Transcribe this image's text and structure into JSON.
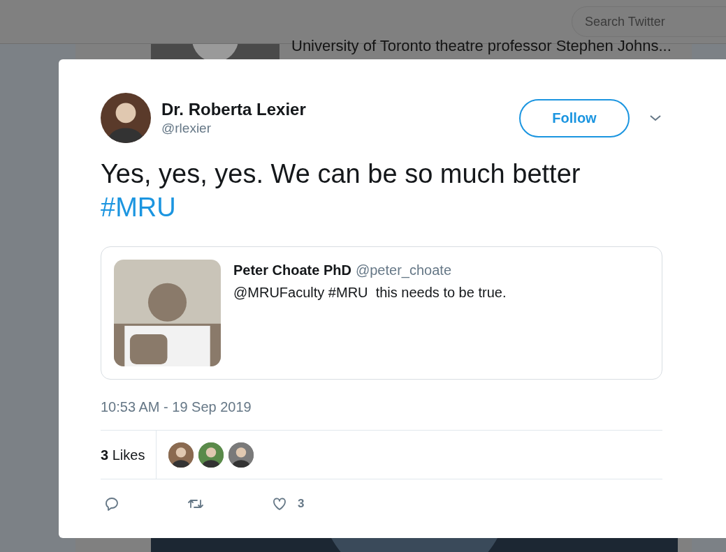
{
  "top_bar": {
    "search": {
      "placeholder": "Search Twitter"
    }
  },
  "background_feed": {
    "headline": "University of Toronto theatre professor Stephen Johns..."
  },
  "tweet": {
    "author": {
      "name": "Dr. Roberta Lexier",
      "handle": "@rlexier"
    },
    "follow_button": "Follow",
    "text_lines": [
      {
        "kind": "plain",
        "text": "Yes, yes, yes. We can be so much better"
      },
      {
        "kind": "hashtag",
        "text": "#MRU"
      }
    ],
    "quoted_tweet": {
      "name": "Peter Choate PhD",
      "handle": "@peter_choate",
      "text": "@MRUFaculty #MRU  this needs to be true."
    },
    "timestamp": "10:53 AM - 19 Sep 2019",
    "likes": {
      "count": "3",
      "label": "Likes"
    },
    "actions": [
      {
        "kind": "reply"
      },
      {
        "kind": "retweet"
      },
      {
        "kind": "like",
        "count": "3"
      }
    ]
  }
}
